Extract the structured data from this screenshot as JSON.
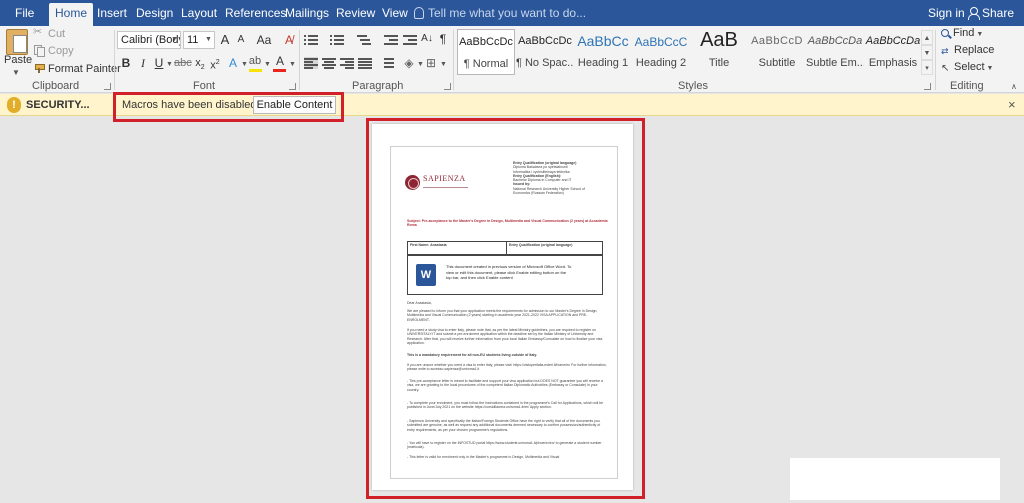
{
  "tabs": [
    "File",
    "Home",
    "Insert",
    "Design",
    "Layout",
    "References",
    "Mailings",
    "Review",
    "View"
  ],
  "active_tab": "Home",
  "tell_me": "Tell me what you want to do...",
  "sign_in": "Sign in",
  "share": "Share",
  "clipboard": {
    "paste": "Paste",
    "cut": "Cut",
    "copy": "Copy",
    "format_painter": "Format Painter",
    "label": "Clipboard"
  },
  "font": {
    "family": "Calibri (Body)",
    "size": "11",
    "grow": "A",
    "shrink": "A",
    "case": "Aa",
    "bold": "B",
    "italic": "I",
    "underline": "U",
    "strike": "abc",
    "subscript": "x",
    "superscript": "x",
    "font_color_glyph": "A",
    "label": "Font"
  },
  "paragraph": {
    "label": "Paragraph"
  },
  "styles": {
    "items": [
      {
        "preview": "AaBbCcDc",
        "name": "¶ Normal"
      },
      {
        "preview": "AaBbCcDc",
        "name": "¶ No Spac..."
      },
      {
        "preview": "AaBbCc",
        "name": "Heading 1"
      },
      {
        "preview": "AaBbCcC",
        "name": "Heading 2"
      },
      {
        "preview": "AaB",
        "name": "Title"
      },
      {
        "preview": "AaBbCcD",
        "name": "Subtitle"
      },
      {
        "preview": "AaBbCcDa",
        "name": "Subtle Em..."
      },
      {
        "preview": "AaBbCcDa",
        "name": "Emphasis"
      }
    ],
    "label": "Styles"
  },
  "editing": {
    "find": "Find",
    "replace": "Replace",
    "select": "Select",
    "label": "Editing"
  },
  "message_bar": {
    "security_label": "SECURITY...",
    "message": "Macros have been disabled.",
    "button": "Enable Content",
    "close": "×"
  },
  "document": {
    "logo": "SAPIENZA",
    "header_lines": [
      "Entry Qualification (original language)",
      "Diploma Bakalavra po spetsialnosti",
      "Informatika i vychislitelnaya tekhnika",
      "Entry Qualification (English):",
      "Bachelor Diploma in Computer and IT",
      "Issued by:",
      "National Research University Higher School of",
      "Economics (Russian Federation)"
    ],
    "subject": "Subject:  Pre-acceptance to the Master's Degree in Design, Multimedia and Visual Communication (2 years) at Accademia Roma",
    "table_left": "First Name: Anastasia",
    "table_right": "Entry Qualification (original language)",
    "word_notice": [
      "This document created in previous version of Microsoft Office Word. To",
      "view or edit this document, please click Enable editing button on the",
      "top bar, and then click Enable content"
    ],
    "salutation": "Dear Anastasia,",
    "paragraphs": [
      "We are pleased to inform you that your application meets the requirements for admission to our Master's Degree in Design, Multimedia and Visual Communication (2 years) starting in academic year 2021-2022 VISA APPLICATION and PRE-ENROLMENT.",
      "If you need a study visa to enter Italy, please note that, as per the latest Ministry guidelines, you are required to register on UNIVERSITALY.IT and submit a pre-enrolment application within the deadline set by the Italian Ministry of University and Research. After that, you will receive further information from your local Italian Embassy/Consulate on how to finalize your visa application.",
      "This is a mandatory requirement for all non-EU students living outside of Italy.",
      "If you are unsure whether you need a visa to enter Italy, please visit: https://vistoperitalia.esteri.it/home/en For further information, please write to accesso.sapienza@uniroma1.it",
      "- This pre-acceptance letter is meant to facilitate and support your visa application but DOES NOT guarantee you will receive a visa, we are granting to the local procedures of the competent Italian Diplomatic Authorities (Embassy or Consulate) in your country.",
      "- To complete your enrolment, you must follow the instructions contained in the programme's Call for Applications, which will be published in June/July 2021 on the website https://corsidilaurea.uniroma1.it/en/ Apply section.",
      "- Sapienza University and specifically the Italian/Foreign Students Office have the right to verify that all of the documents you submitted are genuine, as well as request any additional documents deemed necessary to confirm possession/authenticity of entry requirements, as per your chosen programme's regulations.",
      "- You will have to register on the INFOSTUD portal https://www.studenti.uniroma1.it/phoenix/en/ to generate a student number (matricola).",
      "- This letter is valid for enrolment only in the Master's programme in Design, Multimedia and Visual"
    ]
  }
}
